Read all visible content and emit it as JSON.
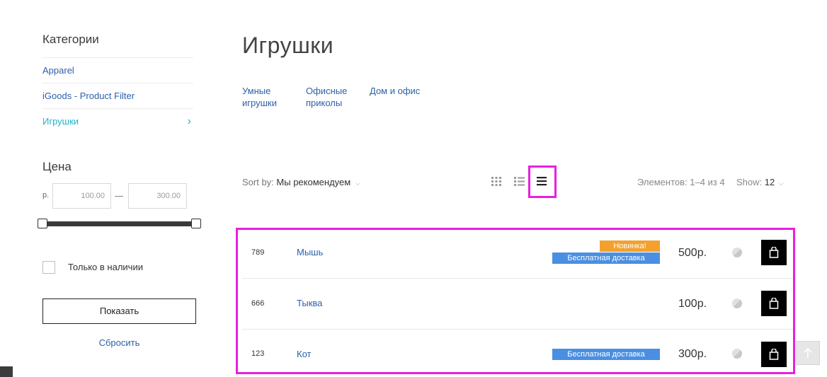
{
  "sidebar": {
    "categories_title": "Категории",
    "categories": [
      {
        "label": "Apparel"
      },
      {
        "label": "iGoods - Product Filter"
      },
      {
        "label": "Игрушки",
        "active": true
      }
    ],
    "price_title": "Цена",
    "currency": "р.",
    "price_min": "100.00",
    "price_max": "300.00",
    "in_stock_label": "Только в наличии",
    "show_button": "Показать",
    "reset_link": "Сбросить"
  },
  "main": {
    "title": "Игрушки",
    "subcategories": [
      "Умные игрушки",
      "Офисные приколы",
      "Дом и офис"
    ],
    "sort_label": "Sort by:",
    "sort_value": "Мы рекомендуем",
    "view_modes": [
      "grid",
      "list",
      "compact-list"
    ],
    "active_view": "compact-list",
    "count_text": "Элементов: 1–4 из 4",
    "show_label": "Show:",
    "show_value": "12"
  },
  "products": [
    {
      "sku": "789",
      "name": "Мышь",
      "badge_new": "Новинка!",
      "badge_ship": "Бесплатная доставка",
      "price": "500р."
    },
    {
      "sku": "666",
      "name": "Тыква",
      "badge_new": "",
      "badge_ship": "",
      "price": "100р."
    },
    {
      "sku": "123",
      "name": "Кот",
      "badge_new": "",
      "badge_ship": "Бесплатная доставка",
      "price": "300р."
    }
  ],
  "colors": {
    "link": "#2d5fa8",
    "active_link": "#1fb5c9",
    "highlight": "#e91ee0",
    "badge_new": "#f2a12f",
    "badge_ship": "#4a8fe2"
  }
}
